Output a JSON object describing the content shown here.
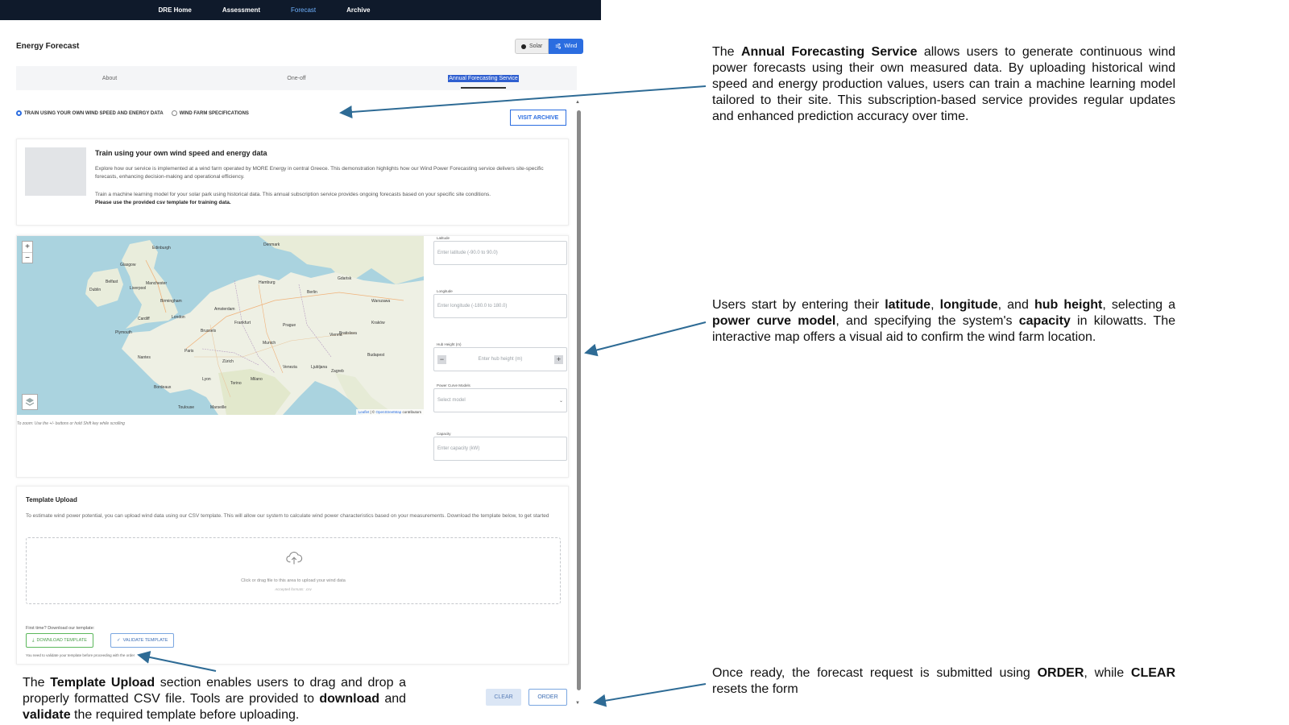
{
  "nav": {
    "items": [
      {
        "label": "DRE Home"
      },
      {
        "label": "Assessment"
      },
      {
        "label": "Forecast"
      },
      {
        "label": "Archive"
      }
    ]
  },
  "page": {
    "title": "Energy Forecast",
    "toggle": {
      "solar": "Solar",
      "wind": "Wind"
    }
  },
  "tabs": [
    {
      "label": "About"
    },
    {
      "label": "One-off"
    },
    {
      "label": "Annual Forecasting Service"
    }
  ],
  "mode": {
    "option_own_data": "TRAIN USING YOUR OWN WIND SPEED AND ENERGY DATA",
    "option_specs": "WIND FARM SPECIFICATIONS",
    "visit_archive": "VISIT ARCHIVE"
  },
  "info": {
    "title": "Train using your own wind speed and energy data",
    "para1": "Explore how our service is implemented at a wind farm operated by MORE Energy in central Greece. This demonstration highlights how our Wind Power Forecasting service delivers site-specific forecasts, enhancing decision-making and operational efficiency.",
    "para2": "Train a machine learning model for your solar park using historical data. This annual subscription service provides ongoing forecasts based on your specific site conditions.",
    "para3": "Please use the provided csv template for training data."
  },
  "map": {
    "zoom_in": "+",
    "zoom_out": "−",
    "attribution_leaflet": "Leaflet",
    "attribution_sep": " | © ",
    "attribution_osm": "OpenStreetMap",
    "attribution_tail": " contributors",
    "hint": "To zoom: Use the +/- buttons or hold Shift key while scrolling",
    "places": [
      "Edinburgh",
      "Glasgow",
      "Belfast",
      "Dublin",
      "Manchester",
      "Liverpool",
      "Birmingham",
      "London",
      "Cardiff",
      "Plymouth",
      "Amsterdam",
      "Hamburg",
      "Berlin",
      "Paris",
      "Brussels",
      "Prague",
      "Munich",
      "Vienna",
      "Warszawa",
      "Lyon",
      "Milano",
      "Torino",
      "Zürich",
      "Budapest",
      "Bordeaux",
      "Nantes",
      "Denmark",
      "Gdańsk",
      "Kraków",
      "Bratislava",
      "Toulouse",
      "Marseille",
      "Venezia",
      "Zagreb",
      "Ljubljana",
      "Frankfurt"
    ]
  },
  "form": {
    "latitude_label": "Latitude",
    "latitude_placeholder": "Enter latitude (-90.0 to 90.0)",
    "longitude_label": "Longitude",
    "longitude_placeholder": "Enter longitude (-180.0 to 180.0)",
    "hub_label": "Hub Height (m)",
    "hub_placeholder": "Enter hub height (m)",
    "curve_label": "Power Curve Models",
    "curve_value": "Select model",
    "capacity_label": "Capacity",
    "capacity_placeholder": "Enter capacity (kW)"
  },
  "upload": {
    "title": "Template Upload",
    "desc": "To estimate wind power potential, you can upload wind data using our CSV template. This will allow our system to calculate wind power characteristics based on your measurements. Download the template below, to get started",
    "drop_text": "Click or drag file to this area to upload your wind data",
    "drop_sub": "Accepted formats: .csv",
    "first_time": "First time? Download our template:",
    "download_btn": "DOWNLOAD TEMPLATE",
    "validate_btn": "VALIDATE TEMPLATE",
    "need_validate": "You need to validate your template before proceeding with the order"
  },
  "actions": {
    "clear": "CLEAR",
    "order": "ORDER"
  },
  "annotations": {
    "n1_a": "The ",
    "n1_b": "Annual Forecasting Service",
    "n1_c": " allows users to generate continuous wind power forecasts using their own measured data. By uploading historical wind speed and energy production values, users can train a machine learning model tailored to their site. This subscription-based service provides regular updates and enhanced prediction accuracy over time.",
    "n2_a": "Users start by entering their ",
    "n2_b": "latitude",
    "n2_c": ", ",
    "n2_d": "longitude",
    "n2_e": ", and ",
    "n2_f": "hub height",
    "n2_g": ", selecting a ",
    "n2_h": "power curve model",
    "n2_i": ", and specifying the system's ",
    "n2_j": "capacity",
    "n2_k": " in kilowatts. The interactive map offers a visual aid to confirm the wind farm location.",
    "n3_a": "Once ready, the forecast request is submitted using ",
    "n3_b": "ORDER",
    "n3_c": ", while ",
    "n3_d": "CLEAR",
    "n3_e": " resets the form",
    "n4_a": "The ",
    "n4_b": "Template Upload",
    "n4_c": " section enables users to drag and drop a properly formatted CSV file. Tools are provided to ",
    "n4_d": "download",
    "n4_e": " and ",
    "n4_f": "validate",
    "n4_g": " the required template before uploading."
  },
  "colors": {
    "nav_bg": "#0f1a2b",
    "accent": "#2b6de0",
    "arrow": "#2e6b95"
  }
}
